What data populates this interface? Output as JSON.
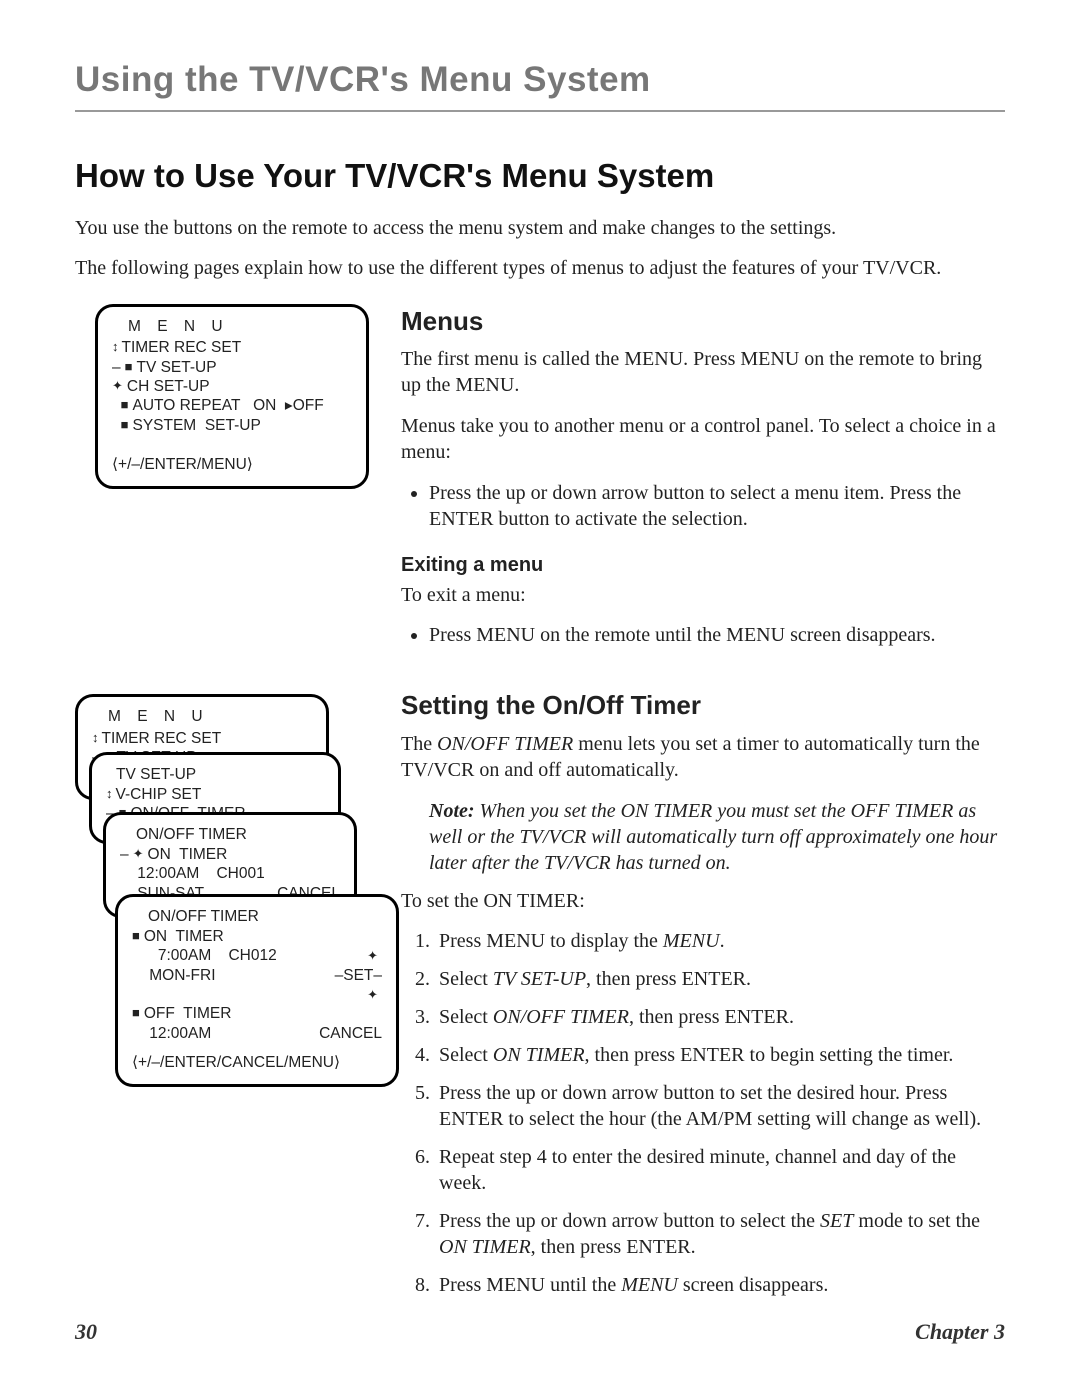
{
  "chapterTitle": "Using the TV/VCR's Menu System",
  "h1": "How to Use Your TV/VCR's Menu System",
  "intro1": "You use the buttons on the remote to access the menu system and make changes to the settings.",
  "intro2": "The following pages explain how to use the different types of menus to adjust the features of your TV/VCR.",
  "menus": {
    "heading": "Menus",
    "p1": "The first menu is called the MENU. Press MENU on the remote to bring up the MENU.",
    "p2": "Menus take you to another menu or a control panel. To select a choice in a menu:",
    "bullet1": "Press the up or down arrow button to select a menu item. Press the ENTER button to activate the selection.",
    "exitHeading": "Exiting a menu",
    "exitIntro": "To exit a menu:",
    "exitBullet": "Press MENU on the remote until the MENU screen disappears."
  },
  "timer": {
    "heading": "Setting the On/Off Timer",
    "p1a": "The ",
    "p1b": "ON/OFF TIMER",
    "p1c": " menu lets you set a timer to automatically turn the TV/VCR on and off automatically.",
    "noteLabel": "Note:",
    "noteBody": "  When you set the ON TIMER you must set the OFF TIMER as well or the TV/VCR will automatically turn off approximately one hour later after the TV/VCR has turned on.",
    "setIntro": "To set the ON TIMER:",
    "steps": {
      "s1a": "Press MENU to display the ",
      "s1b": "MENU",
      "s1c": ".",
      "s2a": "Select ",
      "s2b": "TV SET-UP",
      "s2c": ", then press ENTER.",
      "s3a": "Select ",
      "s3b": "ON/OFF TIMER",
      "s3c": ", then press ENTER.",
      "s4a": "Select ",
      "s4b": "ON TIMER",
      "s4c": ", then press ENTER to begin setting the timer.",
      "s5": "Press the up or down arrow button to set the desired hour. Press ENTER to select the hour (the AM/PM setting will change as well).",
      "s6": "Repeat step 4 to enter the desired minute, channel and day of the week.",
      "s7a": "Press the up or down arrow button to select the ",
      "s7b": "SET",
      "s7c": " mode to set the ",
      "s7d": "ON TIMER",
      "s7e": ", then press ENTER.",
      "s8a": "Press MENU until the ",
      "s8b": "MENU",
      "s8c": " screen disappears."
    }
  },
  "osd1": {
    "title": "M E N U",
    "i1": "TIMER REC SET",
    "i2": "TV SET-UP",
    "i3": "CH SET-UP",
    "i4": "AUTO REPEAT   ON  ▸OFF",
    "i5": "SYSTEM  SET-UP",
    "footer": "⟨+/–/ENTER/MENU⟩"
  },
  "osdA": {
    "title": "M E N U",
    "i1": "TIMER REC SET",
    "i2": "TV SET-UP"
  },
  "osdB": {
    "title": "TV  SET-UP",
    "i1": "V-CHIP SET",
    "i2": "ON/OFF  TIMER"
  },
  "osdC": {
    "title": "ON/OFF  TIMER",
    "i1": "ON  TIMER",
    "line2": "    12:00AM    CH001",
    "i3": "    SUN-SAT",
    "cancel": "CANCEL"
  },
  "osdD": {
    "title": "ON/OFF  TIMER",
    "i1": "ON  TIMER",
    "line2": "      7:00AM    CH012",
    "i3": "    MON-FRI",
    "set": "–SET–",
    "i4": "OFF  TIMER",
    "line5": "    12:00AM",
    "cancel": "CANCEL",
    "footer": "⟨+/–/ENTER/CANCEL/MENU⟩"
  },
  "footer": {
    "page": "30",
    "chapter": "Chapter 3"
  }
}
